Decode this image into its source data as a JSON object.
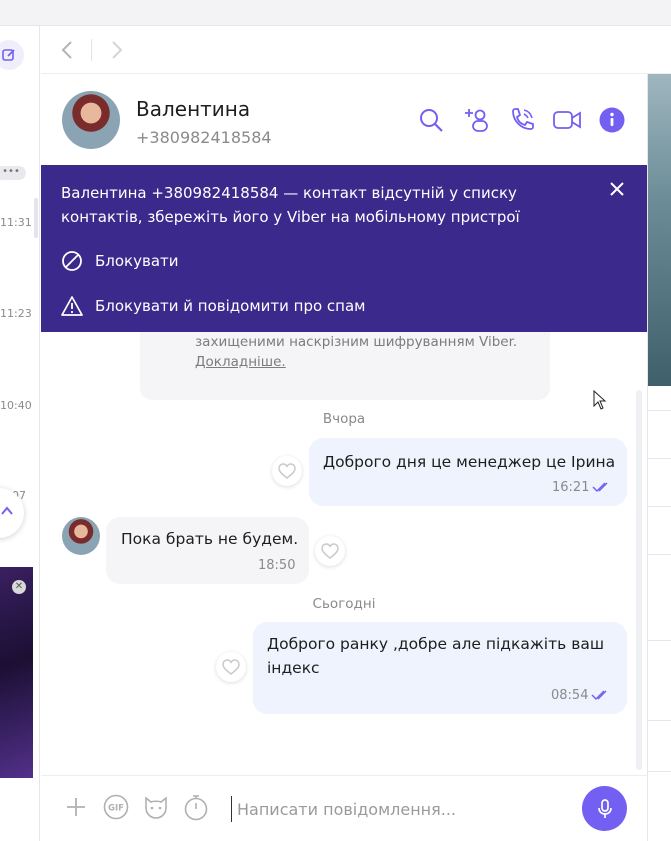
{
  "left_panel": {
    "times": [
      "11:31",
      "11:23",
      "10:40",
      "07"
    ],
    "more": "•••"
  },
  "contact": {
    "name": "Валентина",
    "phone": "+380982418584"
  },
  "banner": {
    "message": "Валентина +380982418584 — контакт відсутній у списку контактів, збережіть його у Viber на мобільному пристрої",
    "block_label": "Блокувати",
    "block_report_label": "Блокувати й повідомити про спам"
  },
  "encryption": {
    "text": "захищеними наскрізним шифруванням Viber.",
    "link": "Докладніше."
  },
  "messages": [
    {
      "type": "date",
      "text": "Вчора"
    },
    {
      "type": "out",
      "text": "Доброго дня це менеджер це Ірина",
      "time": "16:21"
    },
    {
      "type": "in",
      "text": "Пока брать не будем.",
      "time": "18:50"
    },
    {
      "type": "date",
      "text": "Сьогодні"
    },
    {
      "type": "out",
      "text": "Доброго ранку ,добре але підкажіть ваш індекс",
      "time": "08:54"
    }
  ],
  "composer": {
    "placeholder": "Написати повідомлення..."
  },
  "colors": {
    "accent": "#7360f2",
    "banner": "#3b2a8c",
    "outgoing_bubble": "#eef3fd",
    "incoming_bubble": "#f5f5f7"
  },
  "icons": {
    "header": [
      "search-icon",
      "add-participant-icon",
      "call-icon",
      "video-call-icon",
      "info-icon"
    ],
    "composer": [
      "plus-icon",
      "gif-icon",
      "sticker-icon",
      "timer-icon",
      "microphone-icon"
    ]
  }
}
